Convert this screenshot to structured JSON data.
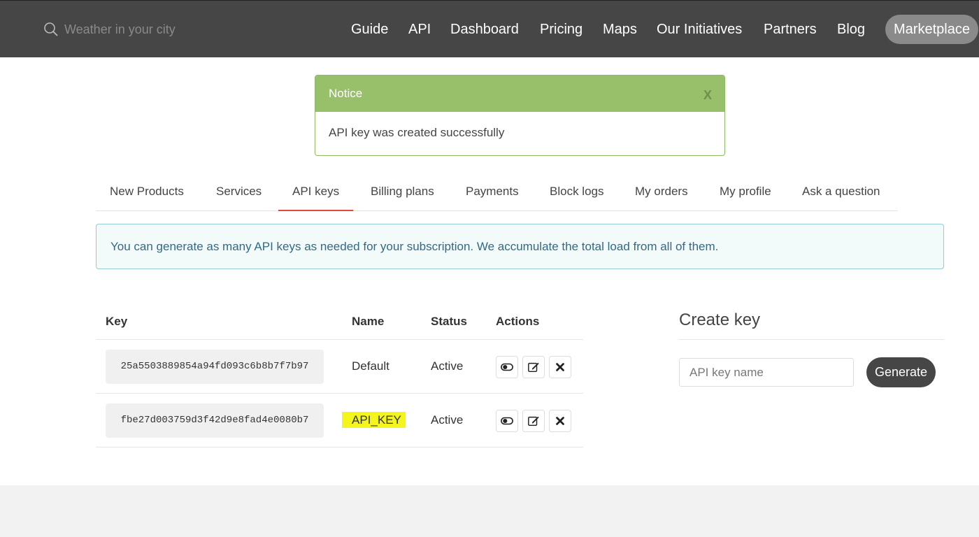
{
  "header": {
    "search_placeholder": "Weather in your city",
    "nav": [
      "Guide",
      "API",
      "Dashboard",
      "Pricing",
      "Maps",
      "Our Initiatives",
      "Partners",
      "Blog",
      "Marketplace"
    ]
  },
  "notice": {
    "title": "Notice",
    "close": "X",
    "message": "API key was created successfully"
  },
  "tabs": [
    "New Products",
    "Services",
    "API keys",
    "Billing plans",
    "Payments",
    "Block logs",
    "My orders",
    "My profile",
    "Ask a question"
  ],
  "active_tab": "API keys",
  "info_text": "You can generate as many API keys as needed for your subscription. We accumulate the total load from all of them.",
  "table": {
    "headers": {
      "key": "Key",
      "name": "Name",
      "status": "Status",
      "actions": "Actions"
    },
    "rows": [
      {
        "key": "25a5503889854a94fd093c6b8b7f7b97",
        "name": "Default",
        "status": "Active"
      },
      {
        "key": "fbe27d003759d3f42d9e8fad4e0080b7",
        "name": "API_KEY",
        "status": "Active"
      }
    ]
  },
  "create_key": {
    "title": "Create key",
    "input_placeholder": "API key name",
    "button": "Generate"
  },
  "colors": {
    "topbar": "#464646",
    "notice_header": "#98bf69",
    "active_tab_underline": "#e2483d",
    "info_text": "#316a86",
    "highlight": "#f5f51e"
  },
  "icons": [
    "search-icon",
    "toggle-icon",
    "edit-icon",
    "delete-icon"
  ]
}
